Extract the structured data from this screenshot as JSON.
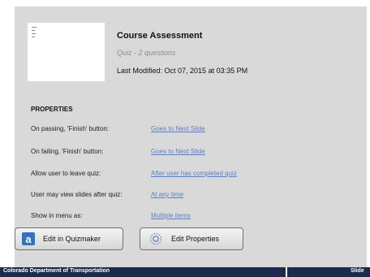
{
  "quiz": {
    "title": "Course Assessment",
    "subtitle": "Quiz - 2 questions",
    "last_modified": "Last Modified: Oct 07, 2015 at 03:35 PM"
  },
  "properties": {
    "heading": "PROPERTIES",
    "rows": [
      {
        "label": "On passing, 'Finish' button:",
        "value": "Goes to Next Slide"
      },
      {
        "label": "On failing, 'Finish' button:",
        "value": "Goes to Next Slide"
      },
      {
        "label": "Allow user to leave quiz:",
        "value": "After user has completed quiz"
      },
      {
        "label": "User may view slides after quiz:",
        "value": "At any time"
      },
      {
        "label": "Show in menu as:",
        "value": "Multiple items"
      }
    ]
  },
  "buttons": {
    "edit_quizmaker": "Edit in Quizmaker",
    "edit_properties": "Edit Properties",
    "quizmaker_icon_glyph": "a"
  },
  "footer": {
    "left": "Colorado Department of Transportation",
    "right": "Slide"
  },
  "icons": {
    "quizmaker": "quizmaker-app-icon",
    "properties": "gear-icon"
  },
  "colors": {
    "link": "#5b7fc2",
    "footer_bg": "#1b2a4d",
    "panel_bg": "#d9d9d9",
    "quizmaker_icon": "#2f74c0"
  }
}
